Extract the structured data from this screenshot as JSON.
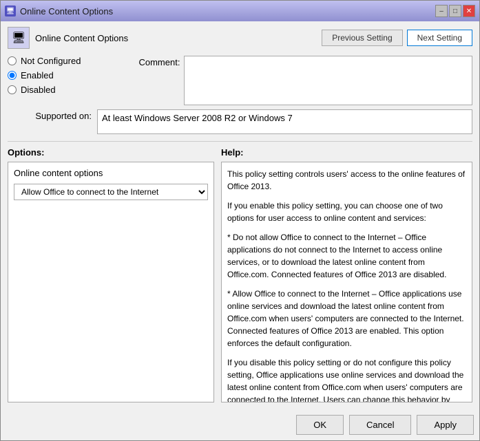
{
  "window": {
    "title": "Online Content Options",
    "icon": "🖥"
  },
  "titlebar": {
    "minimize_label": "–",
    "restore_label": "□",
    "close_label": "✕"
  },
  "section": {
    "title": "Online Content Options"
  },
  "nav": {
    "previous_label": "Previous Setting",
    "next_label": "Next Setting"
  },
  "radio": {
    "not_configured_label": "Not Configured",
    "enabled_label": "Enabled",
    "disabled_label": "Disabled"
  },
  "comment": {
    "label": "Comment:"
  },
  "supported": {
    "label": "Supported on:",
    "value": "At least Windows Server 2008 R2 or Windows 7"
  },
  "options_section": {
    "header": "Options:",
    "box_label": "Online content options",
    "dropdown_value": "Allow Office to connect to the Internet",
    "dropdown_options": [
      "Do not allow Office to connect to the Internet",
      "Allow Office to connect to the Internet"
    ]
  },
  "help_section": {
    "header": "Help:",
    "paragraphs": [
      "This policy setting controls users' access to the online features of Office 2013.",
      "If you enable this policy setting, you can choose one of two options for user access to online content and services:",
      "* Do not allow Office to connect to the Internet – Office applications do not connect to the Internet to access online services, or to download the latest online content from Office.com. Connected features of Office 2013 are disabled.",
      "* Allow Office to connect to the Internet – Office applications use online services and download the latest online content from Office.com when users' computers are connected to the Internet. Connected features of Office 2013 are enabled. This option enforces the default configuration.",
      "If you disable this policy setting or do not configure this policy setting, Office applications use online services and download the latest online content from Office.com when users' computers are connected to the Internet. Users can change this behavior by"
    ]
  },
  "buttons": {
    "ok_label": "OK",
    "cancel_label": "Cancel",
    "apply_label": "Apply"
  }
}
